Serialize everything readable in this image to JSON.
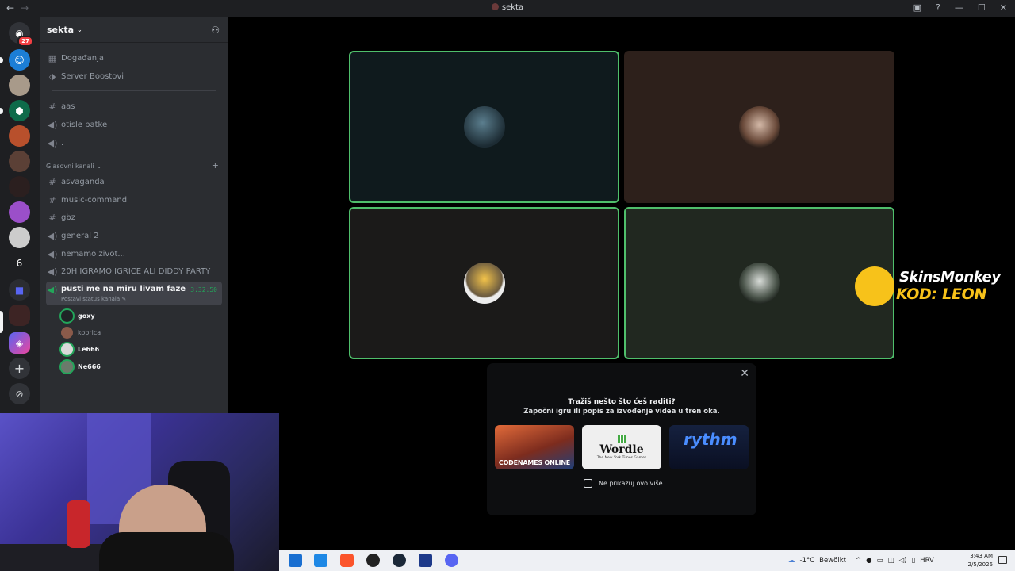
{
  "window": {
    "title": "sekta",
    "back": "←",
    "forward": "→"
  },
  "server_rail": {
    "dm_badge": "27",
    "folder_count": "6"
  },
  "server": {
    "name": "sekta"
  },
  "sidebar": {
    "top_items": [
      {
        "label": "Događanja",
        "icon": "calendar-icon"
      },
      {
        "label": "Server Boostovi",
        "icon": "boost-icon"
      }
    ],
    "channels_top": [
      {
        "label": "aas",
        "type": "text"
      },
      {
        "label": "otisle patke",
        "type": "voice"
      },
      {
        "label": ".",
        "type": "voice"
      }
    ],
    "category": "Glasovni kanali",
    "channels": [
      {
        "label": "asvaganda",
        "type": "text"
      },
      {
        "label": "music-command",
        "type": "text"
      },
      {
        "label": "gbz",
        "type": "text"
      },
      {
        "label": "general 2",
        "type": "voice"
      },
      {
        "label": "nemamo zivot...",
        "type": "voice"
      },
      {
        "label": "20H IGRAMO IGRICE ALI DIDDY PARTY",
        "type": "voice"
      }
    ],
    "active_channel": {
      "label": "pusti me na miru livam faze",
      "timer": "3:32:50",
      "status": "Postavi status kanala"
    },
    "voice_users": [
      {
        "name": "goxy",
        "speaking": true
      },
      {
        "name": "kobrica",
        "speaking": false
      },
      {
        "name": "Le666",
        "speaking": true
      },
      {
        "name": "Ne666",
        "speaking": true
      }
    ]
  },
  "popup": {
    "title": "Tražiš nešto što ćeš raditi?",
    "subtitle": "Započni igru ili popis za izvođenje videa u tren oka.",
    "cards": [
      {
        "name": "CODENAMES ONLINE"
      },
      {
        "name": "Wordle",
        "sub": "The New York Times Games"
      },
      {
        "name": "rythm"
      }
    ],
    "checkbox_label": "Ne prikazuj ovo više"
  },
  "overlay": {
    "brand": "SkinsMonkey",
    "code": "KOD: LEON"
  },
  "taskbar": {
    "weather": "-1°C",
    "weather_desc": "Bewölkt",
    "lang": "HRV",
    "time": "3:43 AM",
    "date": "2/5/2026"
  }
}
